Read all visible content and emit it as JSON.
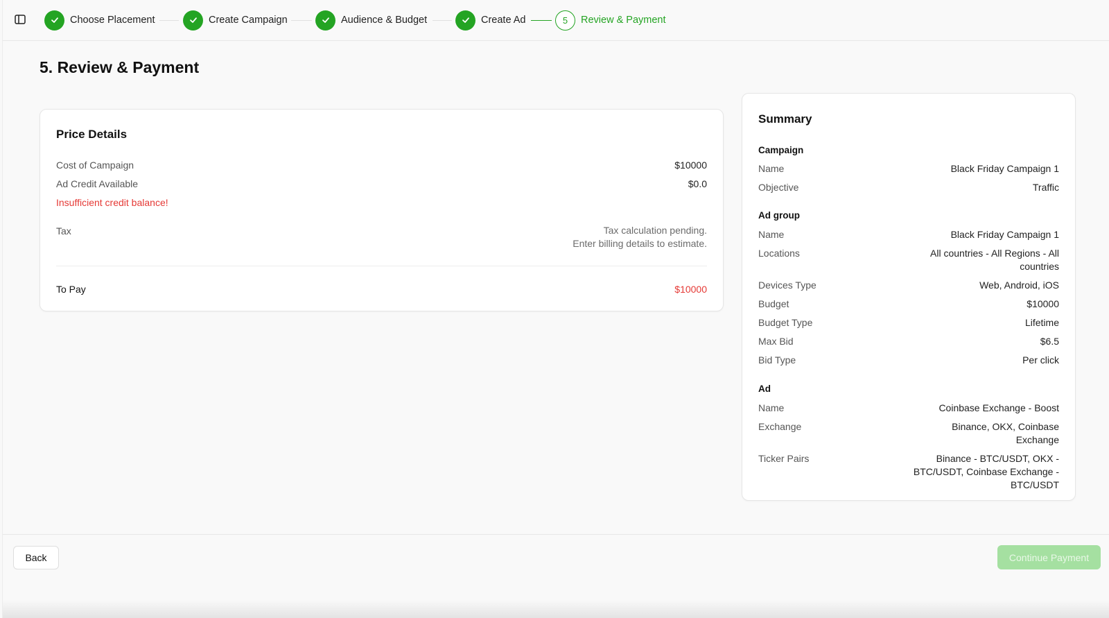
{
  "stepper": {
    "steps": [
      {
        "label": "Choose Placement",
        "status": "complete"
      },
      {
        "label": "Create Campaign",
        "status": "complete"
      },
      {
        "label": "Audience & Budget",
        "status": "complete"
      },
      {
        "label": "Create Ad",
        "status": "complete"
      },
      {
        "label": "Review & Payment",
        "status": "current",
        "number": "5"
      }
    ]
  },
  "page": {
    "title": "5. Review & Payment"
  },
  "price_details": {
    "title": "Price Details",
    "cost_label": "Cost of Campaign",
    "cost_value": "$10000",
    "credit_label": "Ad Credit Available",
    "credit_value": "$0.0",
    "warning": "Insufficient credit balance!",
    "tax_label": "Tax",
    "tax_note_line1": "Tax calculation pending.",
    "tax_note_line2": "Enter billing details to estimate.",
    "to_pay_label": "To Pay",
    "to_pay_value": "$10000"
  },
  "summary": {
    "title": "Summary",
    "campaign": {
      "heading": "Campaign",
      "name_label": "Name",
      "name_value": "Black Friday Campaign 1",
      "objective_label": "Objective",
      "objective_value": "Traffic"
    },
    "ad_group": {
      "heading": "Ad group",
      "name_label": "Name",
      "name_value": "Black Friday Campaign 1",
      "locations_label": "Locations",
      "locations_value": "All countries - All Regions - All countries",
      "devices_label": "Devices Type",
      "devices_value": "Web, Android, iOS",
      "budget_label": "Budget",
      "budget_value": "$10000",
      "budget_type_label": "Budget Type",
      "budget_type_value": "Lifetime",
      "max_bid_label": "Max Bid",
      "max_bid_value": "$6.5",
      "bid_type_label": "Bid Type",
      "bid_type_value": "Per click"
    },
    "ad": {
      "heading": "Ad",
      "name_label": "Name",
      "name_value": "Coinbase Exchange - Boost",
      "exchange_label": "Exchange",
      "exchange_value": "Binance, OKX, Coinbase Exchange",
      "ticker_label": "Ticker Pairs",
      "ticker_value": "Binance - BTC/USDT, OKX - BTC/USDT, Coinbase Exchange - BTC/USDT"
    }
  },
  "footer": {
    "back_label": "Back",
    "continue_label": "Continue Payment"
  },
  "colors": {
    "accent": "#24a423",
    "error": "#e53935",
    "disabled_button": "#a5e0a1"
  }
}
